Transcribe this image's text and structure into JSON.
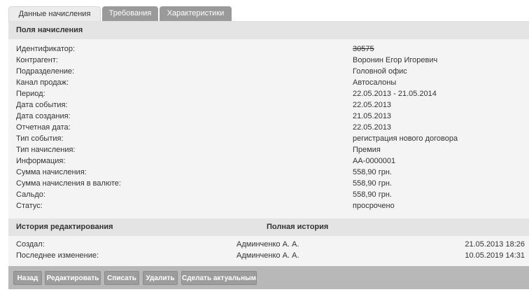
{
  "tabs": [
    {
      "label": "Данные начисления",
      "active": true
    },
    {
      "label": "Требования",
      "active": false
    },
    {
      "label": "Характеристики",
      "active": false
    }
  ],
  "fields_section": {
    "title": "Поля начисления",
    "rows": [
      {
        "label": "Идентификатор:",
        "value": "30575"
      },
      {
        "label": "Контрагент:",
        "value": "Воронин Егор Игоревич"
      },
      {
        "label": "Подразделение:",
        "value": "Головной офис"
      },
      {
        "label": "Канал продаж:",
        "value": "Автосалоны"
      },
      {
        "label": "Период:",
        "value": "22.05.2013 - 21.05.2014"
      },
      {
        "label": "Дата события:",
        "value": "22.05.2013"
      },
      {
        "label": "Дата создания:",
        "value": "21.05.2013"
      },
      {
        "label": "Отчетная дата:",
        "value": "22.05.2013"
      },
      {
        "label": "Тип события:",
        "value": "регистрация нового договора"
      },
      {
        "label": "Тип начисления:",
        "value": "Премия"
      },
      {
        "label": "Информация:",
        "value": "AA-0000001"
      },
      {
        "label": "Сумма начисления:",
        "value": "558,90 грн."
      },
      {
        "label": "Сумма начисления в валюте:",
        "value": "558,90 грн."
      },
      {
        "label": "Сальдо:",
        "value": "558,90 грн."
      },
      {
        "label": "Статус:",
        "value": "просрочено"
      }
    ]
  },
  "history_section": {
    "title": "История редактирования",
    "full_history_link": "Полная история",
    "rows": [
      {
        "label": "Создал:",
        "user": "Админченко А. А.",
        "date": "21.05.2013 18:26"
      },
      {
        "label": "Последнее изменение:",
        "user": "Админченко А. А.",
        "date": "10.05.2019 14:31"
      }
    ]
  },
  "buttons": {
    "back": "Назад",
    "edit": "Редактировать",
    "write_off": "Списать",
    "delete": "Удалить",
    "make_actual": "Сделать актуальным"
  }
}
